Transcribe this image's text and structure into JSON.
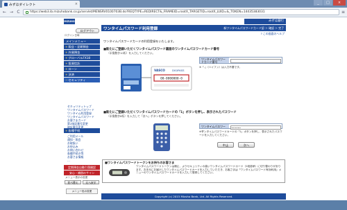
{
  "browser": {
    "tab_title": "みずほダイレクト",
    "tab_close": "×",
    "url": "https://web3.ib.mizuhobank.co.jp/servlet/MENSRV0100703B.do?REQTYPE=REDIRECT&_FRAMEID=rootX_TARGETID=rootX_LUID=&_TOKEN=14435383031",
    "back": "←",
    "forward": "→",
    "reload": "C",
    "menu": "≡",
    "win_min": "_",
    "win_max": "□",
    "win_close": "×"
  },
  "sidebar": {
    "logo": "MIZUHO",
    "logout": "ログアウト",
    "session_time": "ログイン日時",
    "menu": [
      {
        "label": "メインメニュー",
        "plus": ""
      },
      {
        "label": "照会・定期預金",
        "plus": "+"
      },
      {
        "label": "外貨預金",
        "plus": "+"
      },
      {
        "label": "グローバルFX18",
        "plus": "+"
      },
      {
        "label": "投資信託",
        "plus": "+"
      },
      {
        "label": "ローン",
        "plus": "+"
      },
      {
        "label": "決済",
        "plus": "+"
      },
      {
        "label": "セキュリティ",
        "plus": "−"
      }
    ],
    "submenu": [
      "セキュリティトップ",
      "ワンタイムパスワード",
      "ワンタイム利用登録",
      "ワンタイムパスワード",
      "お客さまカード",
      "第2暗証番号変更",
      "暗証番号変更"
    ],
    "settings": {
      "label": "各種手続",
      "plus": "+"
    },
    "submenu2": [
      "ご利用メール",
      "通知・照会",
      "お取扱い",
      "お申込み",
      "お問い合わせ",
      "各種手続き等",
      "お客さま情報",
      "…"
    ],
    "red_btn_1": "定期預金自動引落開設",
    "red_btn_2": "安心・補償のサイン",
    "display_note": "メニュー表示の変更",
    "small_btn_1": "並べ替え",
    "small_btn_2": "元へ戻す",
    "color_btn": "メニュー色の変更"
  },
  "main": {
    "brand": "みずほ銀行",
    "page_title": "ワンタイムパスワード利用登録",
    "breadcrumb": "新ワンタイムパスワードカード認 ＞ 確認 ＞ 完了",
    "help": "? この画面のヘルプ",
    "intro": "ワンタイムパスワードカードの利用登録をいたします。",
    "section1_head": "■新たにご登録いただくワンタイムパスワード裏面のワンタイムパスワードカード番号",
    "section1_sub": "（半角数字10桁）を入力してください。",
    "card_brand": "VASCO",
    "card_brand2": "DIGIPASS",
    "card_number": "00-0000000-0",
    "field1_label": "ワンタイムパスワードカード番号",
    "field1_value": "",
    "field1_note": "※「-」（ハイフン）は入力不要です。",
    "section2_head": "■新たにご登録いただくワンタイムパスワードカードの「1」ボタンを押し、表示されたパスワード",
    "section2_sub": "（半角数字6桁）を入力して「次へ」ボタンを押してください。",
    "field2_label": "ワンタイムパスワード",
    "field2_value": "••••••",
    "field2_note": "※ワンタイムパスワードカードの「1」ボタンを押し、表示されたパスワードを入力してください。",
    "btn_cancel": "中止",
    "btn_next": "次へ",
    "info_title": "■ワンタイムパスワードトークンをお持ちのお客さま",
    "info_text": "ワンタイムパスワードトークンは廃止、よりセキュリティの高いワンタイムパスワードカード（2段認承）に切り替わりがあります。お手元にお届けしたワンタイムパスワードカードを入力していただき、お客さまは「ワンタイムパスワード有効利用」メニューのワンタイムパスワードカードを入力して登録してください。"
  },
  "footer": "Copyright (c) 2015 Mizuho Bank, Ltd. All Rights Reserved."
}
